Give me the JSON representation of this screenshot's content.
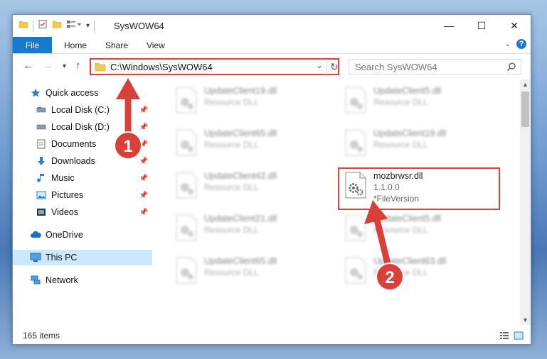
{
  "window": {
    "title": "SysWOW64",
    "buttons": {
      "minimize": "—",
      "maximize": "☐",
      "close": "✕"
    }
  },
  "ribbon": {
    "tabs": [
      "File",
      "Home",
      "Share",
      "View"
    ]
  },
  "address": {
    "path": "C:\\Windows\\SysWOW64"
  },
  "search": {
    "placeholder": "Search SysWOW64"
  },
  "nav": {
    "quick_access": "Quick access",
    "items": [
      {
        "label": "Local Disk (C:)",
        "icon": "drive-icon"
      },
      {
        "label": "Local Disk (D:)",
        "icon": "drive-icon"
      },
      {
        "label": "Documents",
        "icon": "documents-icon"
      },
      {
        "label": "Downloads",
        "icon": "downloads-icon"
      },
      {
        "label": "Music",
        "icon": "music-icon"
      },
      {
        "label": "Pictures",
        "icon": "pictures-icon"
      },
      {
        "label": "Videos",
        "icon": "videos-icon"
      }
    ],
    "onedrive": "OneDrive",
    "this_pc": "This PC",
    "network": "Network"
  },
  "files": {
    "blurred": [
      {
        "name": "UpdateClient19.dll",
        "desc": "Resource DLL"
      },
      {
        "name": "UpdateClient5.dll",
        "desc": "Resource DLL"
      },
      {
        "name": "UpdateClient65.dll",
        "desc": "Resource DLL"
      },
      {
        "name": "UpdateClient19.dll",
        "desc": "Resource DLL"
      },
      {
        "name": "UpdateClient42.dll",
        "desc": "Resource DLL"
      },
      {
        "name": "UpdateClient21.dll",
        "desc": "Resource DLL"
      },
      {
        "name": "UpdateClient5.dll",
        "desc": "Resource DLL"
      },
      {
        "name": "UpdateClient65.dll",
        "desc": "Resource DLL"
      },
      {
        "name": "UpdateClient63.dll",
        "desc": "Resource DLL"
      }
    ],
    "highlighted": {
      "name": "mozbrwsr.dll",
      "version": "1.1.0.0",
      "desc": "*FileVersion"
    }
  },
  "status": {
    "count": "165 items"
  },
  "callouts": [
    "1",
    "2"
  ],
  "colors": {
    "accent": "#1979ca",
    "highlight": "#e53b3b",
    "callout": "#d9403a"
  }
}
